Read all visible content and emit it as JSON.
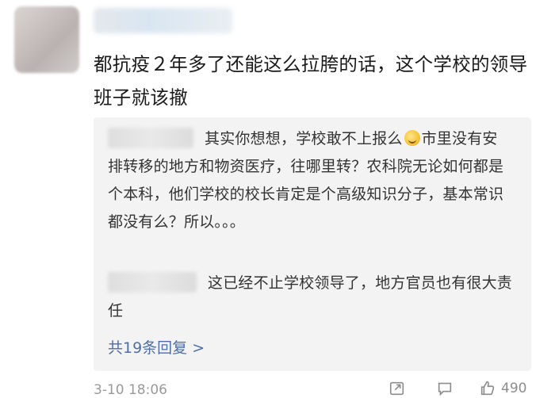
{
  "comment": {
    "text": "都抗疫２年多了还能这么拉胯的话，这个学校的领导班子就该撤"
  },
  "replies": [
    {
      "before_emoji": "其实你想想，学校敢不上报么",
      "after_emoji": "市里没有安排转移的地方和物资医疗，往哪里转？农科院无论如何都是个本科，他们学校的校长肯定是个高级知识分子，基本常识都没有么？所以。。。"
    },
    {
      "text": "这已经不止学校领导了，地方官员也有很大责任"
    }
  ],
  "more_replies_label": "共19条回复 >",
  "footer": {
    "timestamp": "3-10 18:06",
    "like_count": "490"
  },
  "icons": {
    "emoji": "laughing-emoji",
    "forward": "forward-icon",
    "comment": "comment-icon",
    "like": "thumbs-up-icon"
  }
}
